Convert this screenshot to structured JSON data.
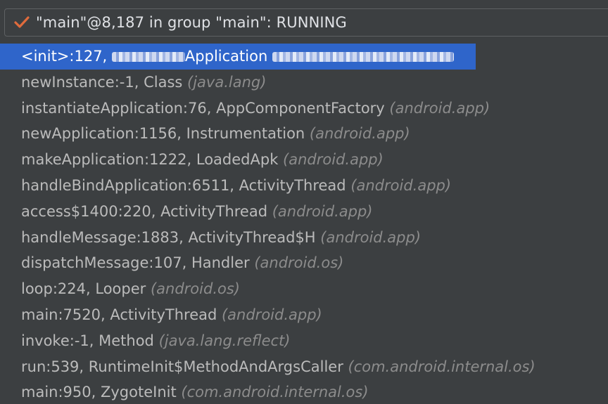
{
  "header": {
    "thread_label": "\"main\"@8,187 in group \"main\": RUNNING",
    "status_icon": "check-icon",
    "status_color": "#e06b3c"
  },
  "frames": [
    {
      "method": "<init>:127, ",
      "cls": "Application ",
      "pkg": "",
      "obscured": true
    },
    {
      "method": "newInstance:-1, ",
      "cls": "Class ",
      "pkg": "(java.lang)"
    },
    {
      "method": "instantiateApplication:76, ",
      "cls": "AppComponentFactory ",
      "pkg": "(android.app)"
    },
    {
      "method": "newApplication:1156, ",
      "cls": "Instrumentation ",
      "pkg": "(android.app)"
    },
    {
      "method": "makeApplication:1222, ",
      "cls": "LoadedApk ",
      "pkg": "(android.app)"
    },
    {
      "method": "handleBindApplication:6511, ",
      "cls": "ActivityThread ",
      "pkg": "(android.app)"
    },
    {
      "method": "access$1400:220, ",
      "cls": "ActivityThread ",
      "pkg": "(android.app)"
    },
    {
      "method": "handleMessage:1883, ",
      "cls": "ActivityThread$H ",
      "pkg": "(android.app)"
    },
    {
      "method": "dispatchMessage:107, ",
      "cls": "Handler ",
      "pkg": "(android.os)"
    },
    {
      "method": "loop:224, ",
      "cls": "Looper ",
      "pkg": "(android.os)"
    },
    {
      "method": "main:7520, ",
      "cls": "ActivityThread ",
      "pkg": "(android.app)"
    },
    {
      "method": "invoke:-1, ",
      "cls": "Method ",
      "pkg": "(java.lang.reflect)"
    },
    {
      "method": "run:539, ",
      "cls": "RuntimeInit$MethodAndArgsCaller ",
      "pkg": "(com.android.internal.os)"
    },
    {
      "method": "main:950, ",
      "cls": "ZygoteInit ",
      "pkg": "(com.android.internal.os)"
    }
  ],
  "selected_index": 0
}
